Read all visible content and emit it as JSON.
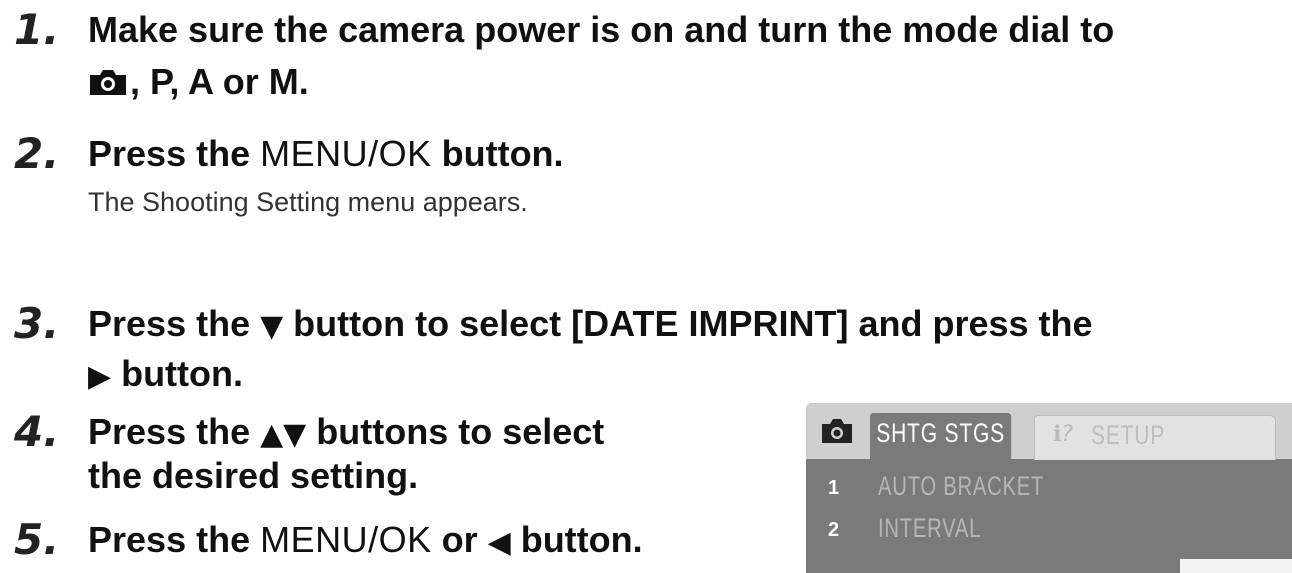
{
  "steps": [
    {
      "num": "1.",
      "line1": "Make sure the camera power is on and turn the mode dial to",
      "line2": ", P, A or M."
    },
    {
      "num": "2.",
      "pre": "Press the ",
      "menu": "MENU/OK",
      "post": " button.",
      "sub": "The Shooting Setting menu appears."
    },
    {
      "num": "3.",
      "line1_pre": "Press the ",
      "line1_post": " button to select [DATE IMPRINT] and press the",
      "line2": " button."
    },
    {
      "num": "4.",
      "line1_pre": "Press the ",
      "line1_post": " buttons to select",
      "line2": "the desired setting."
    },
    {
      "num": "5.",
      "pre": "Press the ",
      "menu": "MENU/OK",
      "mid": " or ",
      "post": " button."
    }
  ],
  "glyphs": {
    "down": "▼",
    "right": "▶",
    "updown": "▲▼",
    "left": "◀"
  },
  "icons": {
    "mode_icon": "camera-icon",
    "setup_tab_icon": "wrench-icon"
  },
  "lcd": {
    "active_tab": "SHTG STGS",
    "inactive_tab": "SETUP",
    "rows": [
      {
        "num": "1",
        "label": "AUTO BRACKET"
      },
      {
        "num": "2",
        "label": "INTERVAL"
      }
    ]
  },
  "colors": {
    "lcd_bg": "#7a7a7a",
    "lcd_header": "#cfcfcf",
    "text": "#111111"
  }
}
